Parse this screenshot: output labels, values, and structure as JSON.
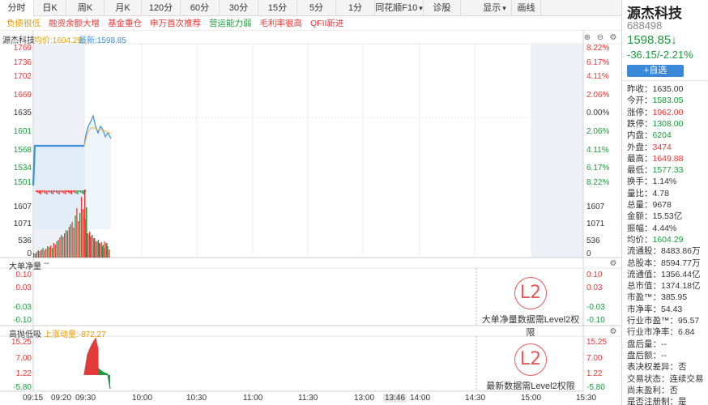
{
  "tabs": [
    "分时",
    "日K",
    "周K",
    "月K",
    "120分",
    "60分",
    "30分",
    "15分",
    "5分",
    "1分",
    "同花顺F10"
  ],
  "tab_f10_caret": "▾",
  "tab_diagnose": "诊股",
  "tab_display": "显示",
  "tab_display_caret": "▾",
  "tab_draw": "画线",
  "tags": [
    {
      "text": "负债很低",
      "color": "#e69a00"
    },
    {
      "text": "融资余额大增",
      "color": "#e23b3b"
    },
    {
      "text": "基金重仓",
      "color": "#e23b3b"
    },
    {
      "text": "申万首次推荐",
      "color": "#e23b3b"
    },
    {
      "text": "营运能力弱",
      "color": "#1b9b3e"
    },
    {
      "text": "毛利率很高",
      "color": "#e23b3b"
    },
    {
      "text": "QFII新进",
      "color": "#e23b3b"
    }
  ],
  "main": {
    "name": "源杰科技",
    "avg_label": "均价:1604.29",
    "last_label": "最新:1598.85",
    "price_ticks": [
      "1769",
      "1736",
      "1702",
      "1669",
      "1635",
      "1601",
      "1568",
      "1534",
      "1501"
    ],
    "pct_ticks": [
      "8.22%",
      "6.17%",
      "4.11%",
      "2.06%",
      "0.00%",
      "2.06%",
      "4.11%",
      "6.17%",
      "8.22%"
    ],
    "vol_ticks": [
      "1607",
      "1071",
      "536",
      "0"
    ]
  },
  "panel1": {
    "title": "大单净量",
    "value": "--",
    "ticks": [
      "0.10",
      "0.03",
      "-0.03",
      "-0.10"
    ],
    "lock_text": "大单净量数据需Level2权限",
    "lock_badge": "L2"
  },
  "panel2": {
    "title": "高抛低吸",
    "value": "上涨动量:-872.27",
    "ticks": [
      "15.25",
      "7.00",
      "1.22",
      "-5.80"
    ],
    "lock_text": "最新数据需Level2权限",
    "lock_badge": "L2"
  },
  "xaxis": [
    "09:15",
    "09:20",
    "09:30",
    "10:00",
    "10:30",
    "11:00",
    "11:30",
    "13:00",
    "13:46",
    "14:00",
    "14:30",
    "15:00",
    "15:30"
  ],
  "quote": {
    "name": "源杰科技",
    "code": "688498",
    "price": "1598.85↓",
    "change": "-36.15/-2.21%",
    "add_button": "+自选",
    "fields": [
      {
        "k": "昨收：",
        "v": "1635.00",
        "c": "dark"
      },
      {
        "k": "今开：",
        "v": "1583.05",
        "c": "green"
      },
      {
        "k": "涨停：",
        "v": "1962.00",
        "c": "red"
      },
      {
        "k": "跌停：",
        "v": "1308.00",
        "c": "green"
      },
      {
        "k": "内盘：",
        "v": "6204",
        "c": "green"
      },
      {
        "k": "外盘：",
        "v": "3474",
        "c": "red"
      },
      {
        "k": "最高：",
        "v": "1649.88",
        "c": "red"
      },
      {
        "k": "最低：",
        "v": "1577.33",
        "c": "green"
      },
      {
        "k": "换手：",
        "v": "1.14%",
        "c": "dark"
      },
      {
        "k": "量比：",
        "v": "4.78",
        "c": "dark"
      },
      {
        "k": "总量：",
        "v": "9678",
        "c": "dark"
      },
      {
        "k": "金额：",
        "v": "15.53亿",
        "c": "dark"
      },
      {
        "k": "振幅：",
        "v": "4.44%",
        "c": "dark"
      },
      {
        "k": "均价：",
        "v": "1604.29",
        "c": "green"
      },
      {
        "k": "流通股：",
        "v": "8483.86万",
        "c": "dark"
      },
      {
        "k": "总股本：",
        "v": "8594.77万",
        "c": "dark"
      },
      {
        "k": "流通值：",
        "v": "1356.44亿",
        "c": "dark"
      },
      {
        "k": "总市值：",
        "v": "1374.18亿",
        "c": "dark"
      },
      {
        "k": "市盈™：",
        "v": "385.95",
        "c": "dark"
      },
      {
        "k": "市净率：",
        "v": "54.43",
        "c": "dark"
      },
      {
        "k": "行业市盈™：",
        "v": "95.57",
        "c": "dark"
      },
      {
        "k": "行业市净率：",
        "v": "6.84",
        "c": "dark"
      },
      {
        "k": "盘后量：",
        "v": "--",
        "c": "dark"
      },
      {
        "k": "盘后额：",
        "v": "--",
        "c": "dark"
      },
      {
        "k": "表决权差异：",
        "v": "否",
        "c": "dark"
      },
      {
        "k": "交易状态：",
        "v": "连续交易",
        "c": "dark"
      },
      {
        "k": "尚未盈利：",
        "v": "否",
        "c": "dark"
      },
      {
        "k": "是否注册制：",
        "v": "是",
        "c": "dark"
      }
    ]
  },
  "colors": {
    "up": "#e23b3b",
    "down": "#1b9b3e",
    "line": "#3b8fd8",
    "avg": "#e6b04a"
  }
}
